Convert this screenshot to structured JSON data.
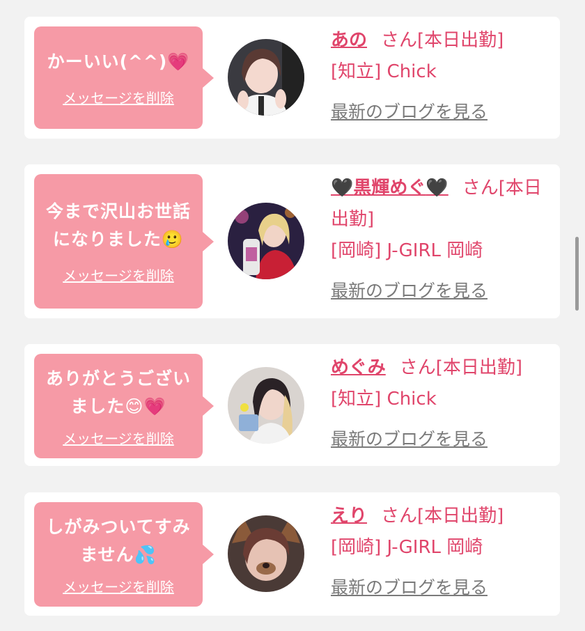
{
  "colors": {
    "accent": "#e0456b",
    "bubble": "#f69aa6",
    "link_gray": "#7a7a7a"
  },
  "cards": [
    {
      "message": "かーいい(^^)💗",
      "delete_label": "メッセージを削除",
      "name": "あの",
      "suffix": "さん[本日出勤]",
      "shop": "[知立] Chick",
      "blog_label": "最新のブログを見る"
    },
    {
      "message_line1": "今まで沢山お世話",
      "message_line2": "になりました🥲",
      "delete_label": "メッセージを削除",
      "name_heart_left": "🖤",
      "name": "黒輝めぐ",
      "name_heart_right": "🖤",
      "suffix": "さん[本日出勤]",
      "shop": "[岡崎] J-GIRL 岡崎",
      "blog_label": "最新のブログを見る"
    },
    {
      "message_line1": "ありがとうござい",
      "message_line2": "ました😊💗",
      "delete_label": "メッセージを削除",
      "name": "めぐみ",
      "suffix": "さん[本日出勤]",
      "shop": "[知立] Chick",
      "blog_label": "最新のブログを見る"
    },
    {
      "message_line1": "しがみついてすみ",
      "message_line2": "ません💦",
      "delete_label": "メッセージを削除",
      "name": "えり",
      "suffix": "さん[本日出勤]",
      "shop": "[岡崎] J-GIRL 岡崎",
      "blog_label": "最新のブログを見る"
    }
  ]
}
